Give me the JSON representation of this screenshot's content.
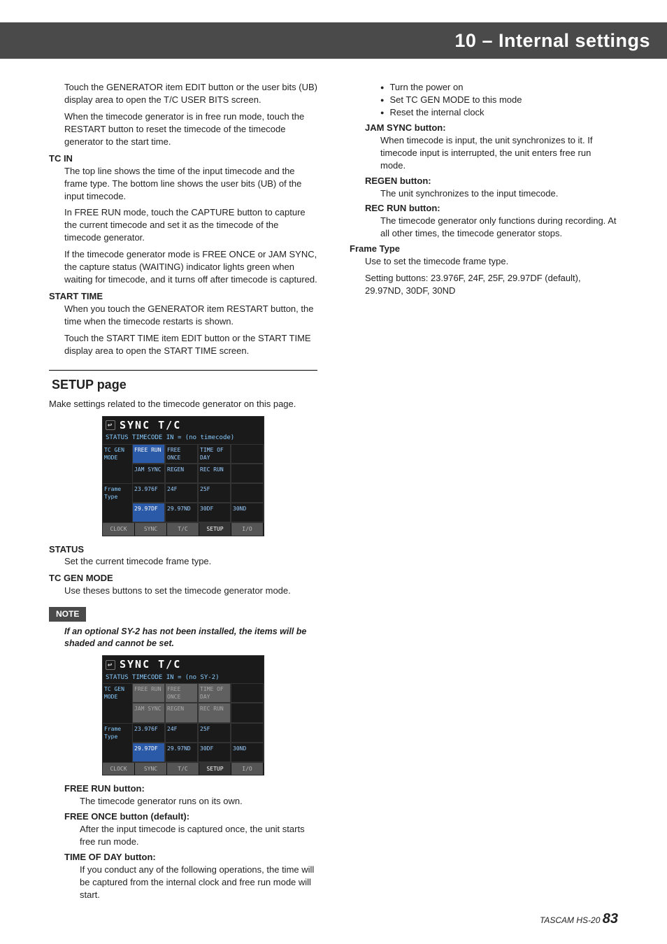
{
  "header": {
    "title": "10 – Internal settings"
  },
  "left": {
    "p1": "Touch the GENERATOR item EDIT button or the user bits (UB) display area to open the T/C USER BITS screen.",
    "p2": "When the timecode generator is in free run mode, touch the RESTART button to reset the timecode of the timecode generator to the start time.",
    "tc_in": "TC IN",
    "tc_in_p1": "The top line shows the time of the input timecode and the frame type. The bottom line shows the user bits (UB) of the input timecode.",
    "tc_in_p2": "In FREE RUN mode, touch the CAPTURE button to capture the current timecode and set it as the timecode of the timecode generator.",
    "tc_in_p3": "If the timecode generator mode is FREE ONCE or JAM SYNC, the capture status (WAITING) indicator lights green when waiting for timecode, and it turns off after timecode is captured.",
    "start_time": "START TIME",
    "start_p1": "When you touch the GENERATOR item RESTART button, the time when the timecode restarts is shown.",
    "start_p2": "Touch the START TIME item EDIT button or the START TIME display area to open the START TIME screen.",
    "setup_title": "SETUP page",
    "setup_intro": "Make settings related to the timecode generator on this page.",
    "status": "STATUS",
    "status_p": "Set the current timecode frame type.",
    "tc_gen_mode": "TC GEN MODE",
    "tc_gen_p": "Use theses buttons to set the timecode generator mode.",
    "note": "NOTE",
    "note_text": "If an optional SY-2 has not been installed, the items will be shaded and cannot be set.",
    "free_run": "FREE RUN button:",
    "free_run_p": "The timecode generator runs on its own.",
    "free_once": "FREE ONCE button (default):",
    "free_once_p": "After the input timecode is captured once, the unit starts free run mode.",
    "tod": "TIME OF DAY button:",
    "tod_p": "If you conduct any of the following operations, the time will be captured from the internal clock and free run mode will start."
  },
  "right": {
    "b1": "Turn the power on",
    "b2": "Set TC GEN MODE to this mode",
    "b3": "Reset the internal clock",
    "jam": "JAM SYNC button:",
    "jam_p": "When timecode is input, the unit synchronizes to it. If timecode input is interrupted, the unit enters free run mode.",
    "regen": "REGEN button:",
    "regen_p": "The unit synchronizes to the input timecode.",
    "recrun": "REC RUN button:",
    "recrun_p": "The timecode generator only functions during recording. At all other times, the timecode generator stops.",
    "frame_type": "Frame Type",
    "frame_p1": "Use to set the timecode frame type.",
    "frame_p2": "Setting buttons: 23.976F, 24F, 25F, 29.97DF (default), 29.97ND, 30DF, 30ND"
  },
  "dev": {
    "title": "SYNC T/C",
    "status1": "STATUS  TIMECODE  IN = (no timecode)",
    "status2": "STATUS  TIMECODE  IN = (no SY-2)",
    "side1": "TC GEN MODE",
    "side2": "Frame Type",
    "r1": [
      "FREE RUN",
      "FREE ONCE",
      "TIME OF DAY",
      ""
    ],
    "r2": [
      "JAM SYNC",
      "REGEN",
      "REC RUN",
      ""
    ],
    "r3": [
      "23.976F",
      "24F",
      "25F",
      ""
    ],
    "r4": [
      "29.97DF",
      "29.97ND",
      "30DF",
      "30ND"
    ],
    "tabs": [
      "CLOCK",
      "SYNC",
      "T/C",
      "SETUP",
      "I/O"
    ]
  },
  "footer": {
    "model": "TASCAM HS-20",
    "page": "83"
  }
}
